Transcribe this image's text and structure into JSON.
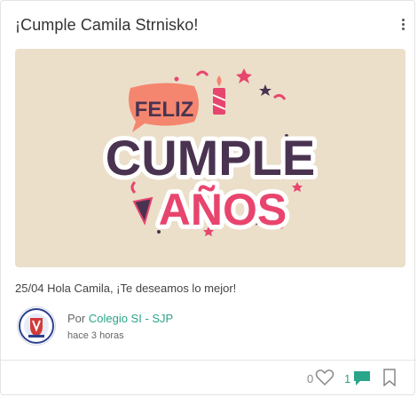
{
  "post": {
    "title": "¡Cumple Camila Strnisko!",
    "body": "25/04 Hola Camila, ¡Te deseamos lo mejor!",
    "author_prefix": "Por",
    "author_name": "Colegio SI - SJP",
    "timestamp": "hace 3 horas"
  },
  "image": {
    "word_1": "FELIZ",
    "word_2": "CUMPLE",
    "word_3": "AÑOS"
  },
  "footer": {
    "likes_count": "0",
    "comments_count": "1"
  },
  "colors": {
    "accent": "#2aa58a",
    "hero_bg": "#ebdfca",
    "pink": "#e8456e",
    "dark_purple": "#4a3350",
    "salmon": "#f4866f"
  }
}
